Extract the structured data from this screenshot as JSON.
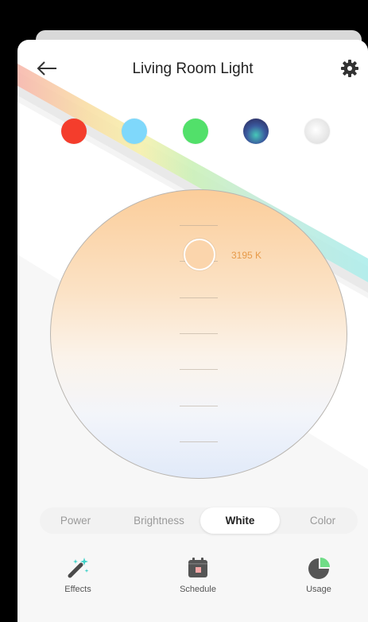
{
  "header": {
    "title": "Living Room Light",
    "back_icon": "arrow-left-icon",
    "settings_icon": "gear-icon"
  },
  "presets": [
    {
      "name": "red",
      "color": "#f43d2c"
    },
    {
      "name": "light-blue",
      "color": "#7fd8fb"
    },
    {
      "name": "green",
      "color": "#52e06a"
    },
    {
      "name": "aurora",
      "color": "#4a3a8c"
    },
    {
      "name": "white",
      "color": "#e6e6e6"
    }
  ],
  "white_mode": {
    "temperature_label": "3195 K",
    "temperature_color": "#e79b4a"
  },
  "mode_tabs": [
    {
      "label": "Power",
      "active": false
    },
    {
      "label": "Brightness",
      "active": false
    },
    {
      "label": "White",
      "active": true
    },
    {
      "label": "Color",
      "active": false
    }
  ],
  "bottom_nav": [
    {
      "label": "Effects",
      "icon": "magic-wand-icon"
    },
    {
      "label": "Schedule",
      "icon": "calendar-icon"
    },
    {
      "label": "Usage",
      "icon": "pie-chart-icon"
    }
  ]
}
